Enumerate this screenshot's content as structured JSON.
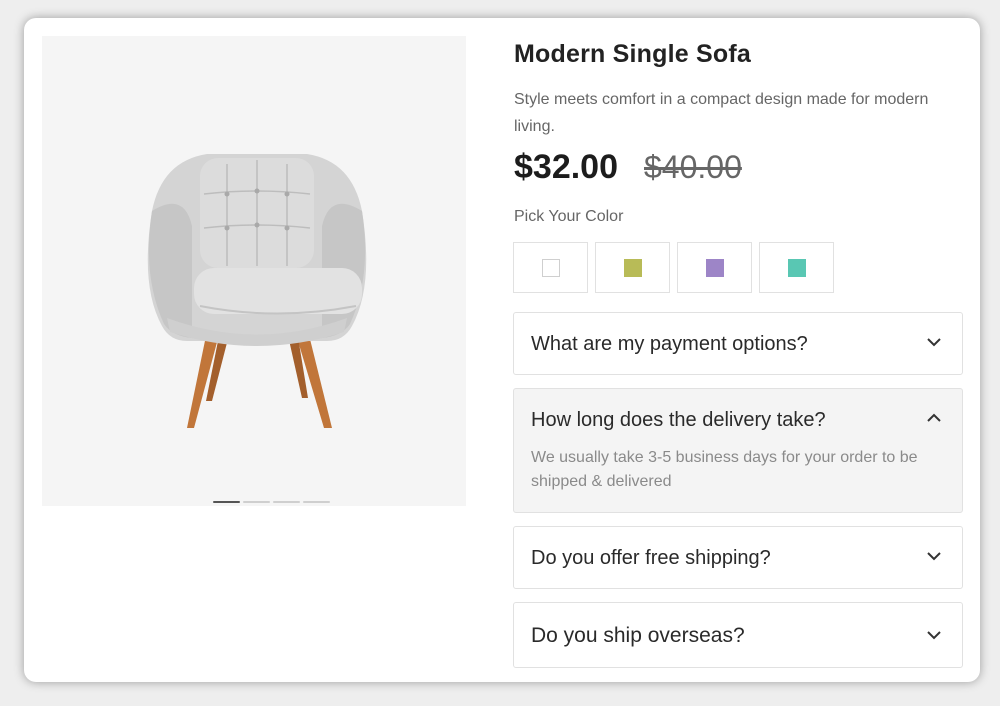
{
  "product": {
    "title": "Modern Single Sofa",
    "description": "Style meets comfort in a compact design made for modern living.",
    "price": "$32.00",
    "original_price": "$40.00",
    "color_label": "Pick Your Color",
    "colors": [
      {
        "name": "white-swatch",
        "hex": "#ffffff"
      },
      {
        "name": "olive-swatch",
        "hex": "#b8bb57"
      },
      {
        "name": "purple-swatch",
        "hex": "#9d85c7"
      },
      {
        "name": "teal-swatch",
        "hex": "#59c7b3"
      }
    ],
    "gallery": {
      "slide_count": 4,
      "active_slide": 1
    }
  },
  "faq": [
    {
      "question": "What are my payment options?",
      "answer": "",
      "open": false,
      "icon": "chevron-down-icon"
    },
    {
      "question": "How long does the delivery take?",
      "answer": "We usually take 3-5 business days for your order to be shipped & delivered",
      "open": true,
      "icon": "chevron-up-icon"
    },
    {
      "question": "Do you offer free shipping?",
      "answer": "",
      "open": false,
      "icon": "chevron-down-icon"
    },
    {
      "question": "Do you ship overseas?",
      "answer": "",
      "open": false,
      "icon": "chevron-down-icon"
    }
  ]
}
